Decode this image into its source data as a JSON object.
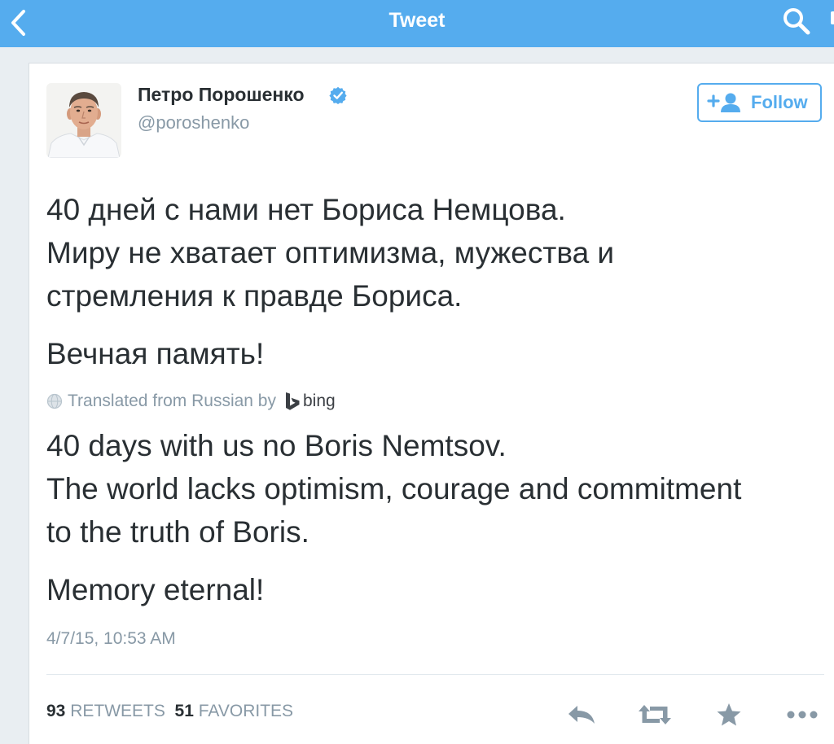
{
  "navbar": {
    "title": "Tweet",
    "back_icon": "chevron-left-icon",
    "search_icon": "search-icon"
  },
  "author": {
    "name": "Петро Порошенко",
    "handle": "@poroshenko",
    "verified": true,
    "avatar": "profile-photo"
  },
  "follow_button": {
    "label": "Follow",
    "icon": "add-user-icon"
  },
  "tweet": {
    "original_lines": [
      "40 дней с нами нет Бориса Немцова.",
      "Миру не хватает оптимизма, мужества и",
      "стремления к правде Бориса.",
      "Вечная память!"
    ],
    "translation_note": {
      "text": "Translated from Russian by",
      "provider": "bing",
      "icon": "globe-icon",
      "provider_icon": "bing-logo-icon"
    },
    "translated_lines": [
      "40 days with us no Boris Nemtsov.",
      "The world lacks optimism, courage and commitment",
      "to the truth of Boris.",
      "Memory eternal!"
    ],
    "timestamp": "4/7/15, 10:53 AM"
  },
  "stats": {
    "retweets_count": "93",
    "retweets_label": "RETWEETS",
    "favorites_count": "51",
    "favorites_label": "FAVORITES"
  },
  "actions": [
    "reply-icon",
    "retweet-icon",
    "favorite-star-icon",
    "more-icon"
  ],
  "colors": {
    "brand_blue": "#55acee",
    "text_primary": "#292f33",
    "text_secondary": "#8899a6",
    "action_gray": "#8899a6",
    "background": "#e9eef2"
  }
}
